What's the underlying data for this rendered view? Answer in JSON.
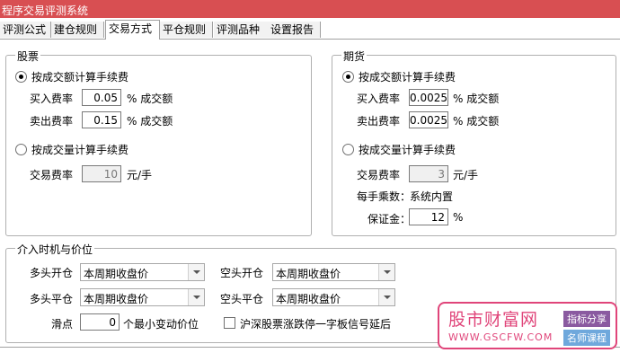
{
  "window": {
    "title": "程序交易评测系统"
  },
  "tabs": [
    "评测公式",
    "建仓规则",
    "交易方式",
    "平仓规则",
    "评测品种",
    "设置报告"
  ],
  "stock": {
    "legend": "股票",
    "by_amount_label": "按成交额计算手续费",
    "buy_rate_label": "买入费率",
    "buy_rate": "0.05",
    "sell_rate_label": "卖出费率",
    "sell_rate": "0.15",
    "pct_unit": "% 成交额",
    "by_volume_label": "按成交量计算手续费",
    "trade_rate_label": "交易费率",
    "trade_rate": "10",
    "trade_unit": "元/手"
  },
  "futures": {
    "legend": "期货",
    "by_amount_label": "按成交额计算手续费",
    "buy_rate_label": "买入费率",
    "buy_rate": "0.0025",
    "sell_rate_label": "卖出费率",
    "sell_rate": "0.0025",
    "pct_unit": "% 成交额",
    "by_volume_label": "按成交量计算手续费",
    "trade_rate_label": "交易费率",
    "trade_rate": "3",
    "trade_unit": "元/手",
    "multiplier_label": "每手乘数：",
    "multiplier_value": "系统内置",
    "margin_label": "保证金：",
    "margin": "12",
    "margin_unit": "%"
  },
  "timing": {
    "legend": "介入时机与价位",
    "long_open_label": "多头开仓",
    "long_open": "本周期收盘价",
    "short_open_label": "空头开仓",
    "short_open": "本周期收盘价",
    "long_close_label": "多头平仓",
    "long_close": "本周期收盘价",
    "short_close_label": "空头平仓",
    "short_close": "本周期收盘价",
    "slippage_label": "滑点",
    "slippage": "0",
    "slippage_unit": "个最小变动价位",
    "limit_checkbox_label": "沪深股票涨跌停一字板信号延后"
  },
  "watermark": {
    "title": "股市财富网",
    "url": "WWW.GSCFW.COM",
    "badge1": "指标分享",
    "badge2": "名师课程"
  }
}
